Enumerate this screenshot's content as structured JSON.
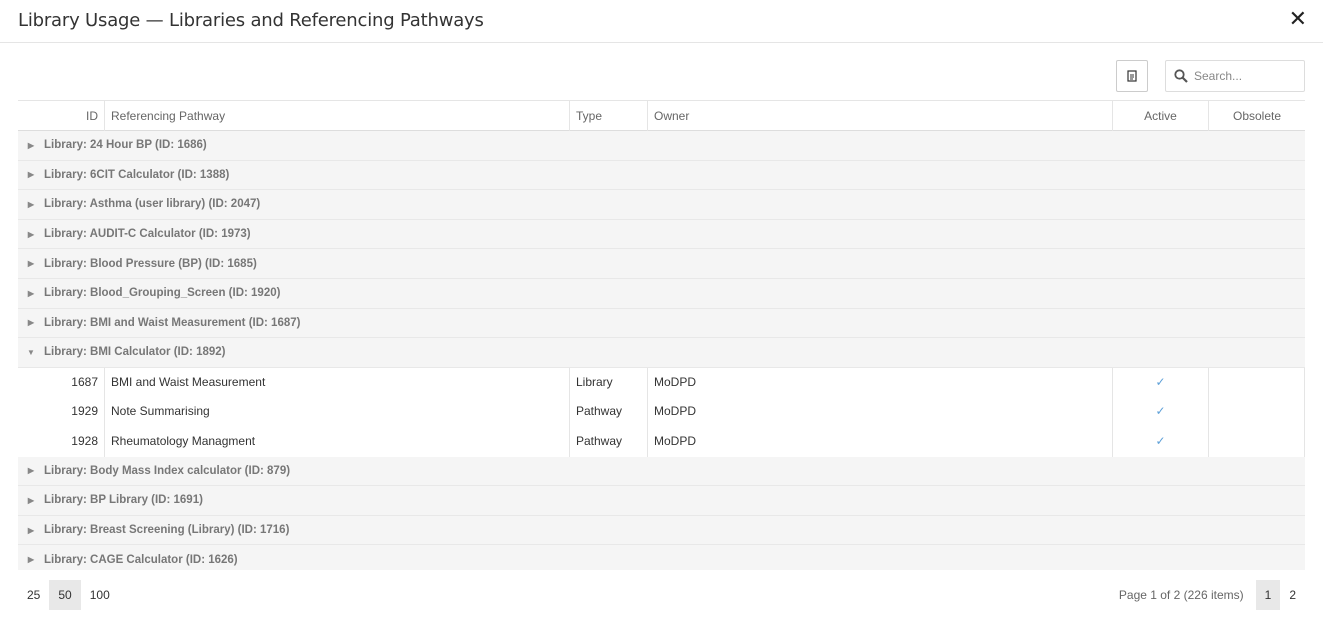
{
  "modal": {
    "title": "Library Usage — Libraries and Referencing Pathways",
    "close_glyph": "✕"
  },
  "toolbar": {
    "export_icon": "export-document-icon",
    "search_placeholder": "Search...",
    "search_value": ""
  },
  "columns": {
    "id": "ID",
    "path": "Referencing Pathway",
    "type": "Type",
    "owner": "Owner",
    "active": "Active",
    "obsolete": "Obsolete"
  },
  "groups": [
    {
      "label": "Library: 24 Hour BP (ID: 1686)",
      "expanded": false,
      "rows": []
    },
    {
      "label": "Library: 6CIT Calculator (ID: 1388)",
      "expanded": false,
      "rows": []
    },
    {
      "label": "Library: Asthma (user library) (ID: 2047)",
      "expanded": false,
      "rows": []
    },
    {
      "label": "Library: AUDIT-C Calculator (ID: 1973)",
      "expanded": false,
      "rows": []
    },
    {
      "label": "Library: Blood Pressure (BP) (ID: 1685)",
      "expanded": false,
      "rows": []
    },
    {
      "label": "Library: Blood_Grouping_Screen (ID: 1920)",
      "expanded": false,
      "rows": []
    },
    {
      "label": "Library: BMI and Waist Measurement (ID: 1687)",
      "expanded": false,
      "rows": []
    },
    {
      "label": "Library: BMI Calculator (ID: 1892)",
      "expanded": true,
      "rows": [
        {
          "id": "1687",
          "path": "BMI and Waist Measurement",
          "type": "Library",
          "owner": "MoDPD",
          "active": true,
          "obsolete": false
        },
        {
          "id": "1929",
          "path": "Note Summarising",
          "type": "Pathway",
          "owner": "MoDPD",
          "active": true,
          "obsolete": false
        },
        {
          "id": "1928",
          "path": "Rheumatology Managment",
          "type": "Pathway",
          "owner": "MoDPD",
          "active": true,
          "obsolete": false
        }
      ]
    },
    {
      "label": "Library: Body Mass Index calculator (ID: 879)",
      "expanded": false,
      "rows": []
    },
    {
      "label": "Library: BP Library (ID: 1691)",
      "expanded": false,
      "rows": []
    },
    {
      "label": "Library: Breast Screening (Library) (ID: 1716)",
      "expanded": false,
      "rows": []
    },
    {
      "label": "Library: CAGE Calculator (ID: 1626)",
      "expanded": false,
      "rows": []
    }
  ],
  "check_glyph": "✓",
  "caret_collapsed": "▶",
  "caret_expanded": "▼",
  "footer": {
    "page_sizes": [
      "25",
      "50",
      "100"
    ],
    "active_page_size": "50",
    "info": "Page 1 of 2 (226 items)",
    "pages": [
      "1",
      "2"
    ],
    "current_page": "1"
  },
  "accent_color": "#5ea0d8"
}
